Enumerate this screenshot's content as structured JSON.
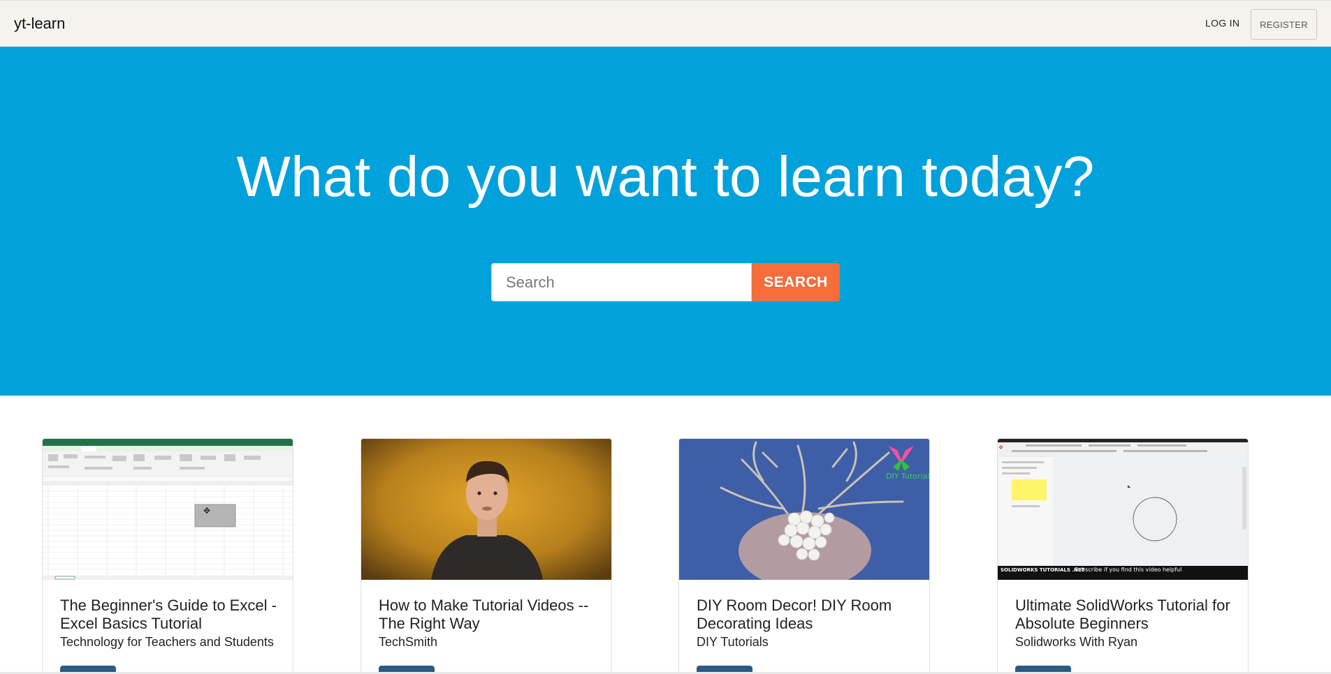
{
  "navbar": {
    "brand": "yt-learn",
    "login_label": "LOG IN",
    "register_label": "REGISTER"
  },
  "hero": {
    "title": "What do you want to learn today?",
    "search_placeholder": "Search",
    "search_value": "",
    "search_button_label": "SEARCH"
  },
  "colors": {
    "hero_bg": "#01a1db",
    "search_button": "#f46d3b",
    "card_button": "#2b5a82",
    "navbar_bg": "#f5f3ee"
  },
  "videos": [
    {
      "title": "The Beginner's Guide to Excel - Excel Basics Tutorial",
      "channel": "Technology for Teachers and Students",
      "thumbnail": "excel-spreadsheet-thumbnail"
    },
    {
      "title": "How to Make Tutorial Videos -- The Right Way",
      "channel": "TechSmith",
      "thumbnail": "presenter-thumbnail"
    },
    {
      "title": "DIY Room Decor! DIY Room Decorating Ideas",
      "channel": "DIY Tutorials",
      "thumbnail": "craft-thumbnail",
      "thumb_overlay": "DIY Tutorials"
    },
    {
      "title": "Ultimate SolidWorks Tutorial for Absolute Beginners",
      "channel": "Solidworks With Ryan",
      "thumbnail": "cad-thumbnail",
      "thumb_brand": "SOLIDWORKS TUTORIALS .NET",
      "thumb_caption": "Subscribe if you find this video helpful"
    }
  ]
}
